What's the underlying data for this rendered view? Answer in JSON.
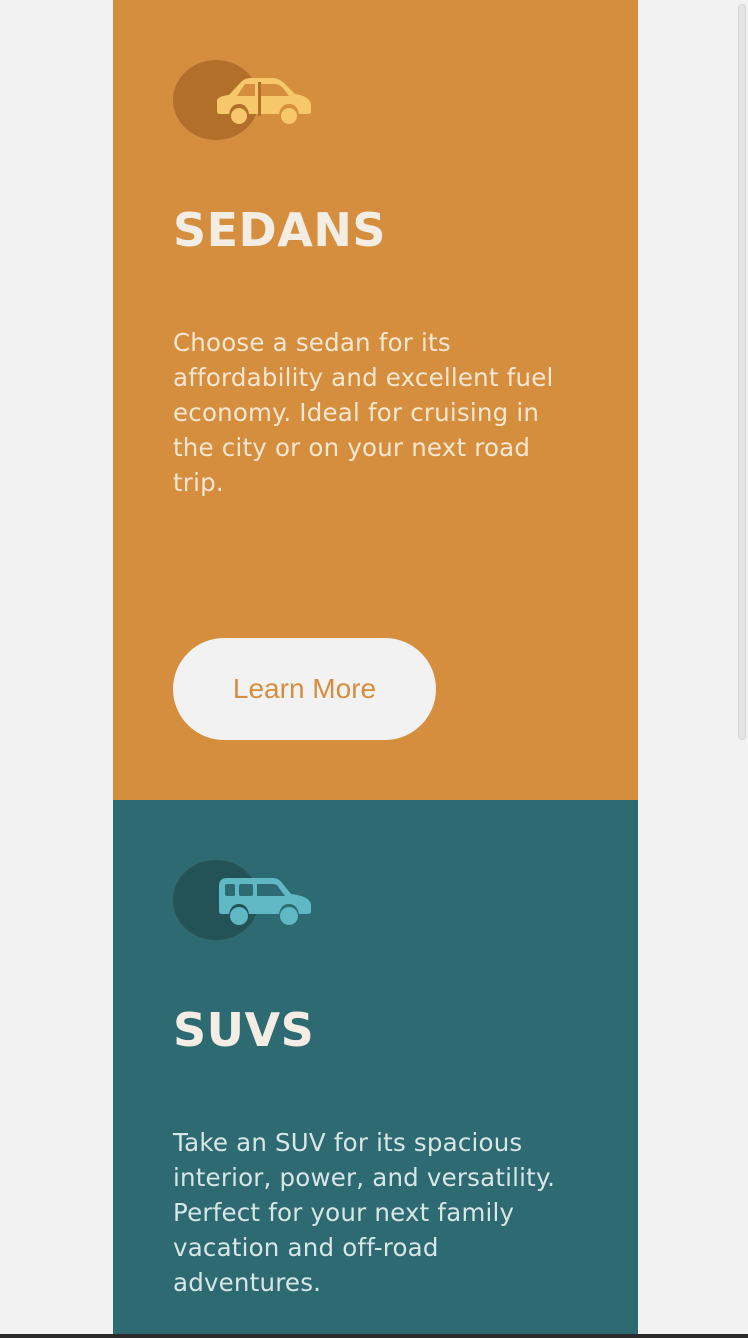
{
  "colors": {
    "page_background": "#f2f2f2",
    "sedans_card": "#d58e3d",
    "suvs_card": "#2d6a71",
    "button_background": "#f2f2f2",
    "button_text": "#d58e3d"
  },
  "cards": {
    "sedans": {
      "icon": "sedan-car-icon",
      "title": "SEDANS",
      "text": "Choose a sedan for its affordability and excellent fuel economy. Ideal for cruising in the city or on your next road trip.",
      "button_label": "Learn More"
    },
    "suvs": {
      "icon": "suv-car-icon",
      "title": "SUVS",
      "text": "Take an SUV for its spacious interior, power, and versatility. Perfect for your next family vacation and off-road adventures."
    }
  }
}
